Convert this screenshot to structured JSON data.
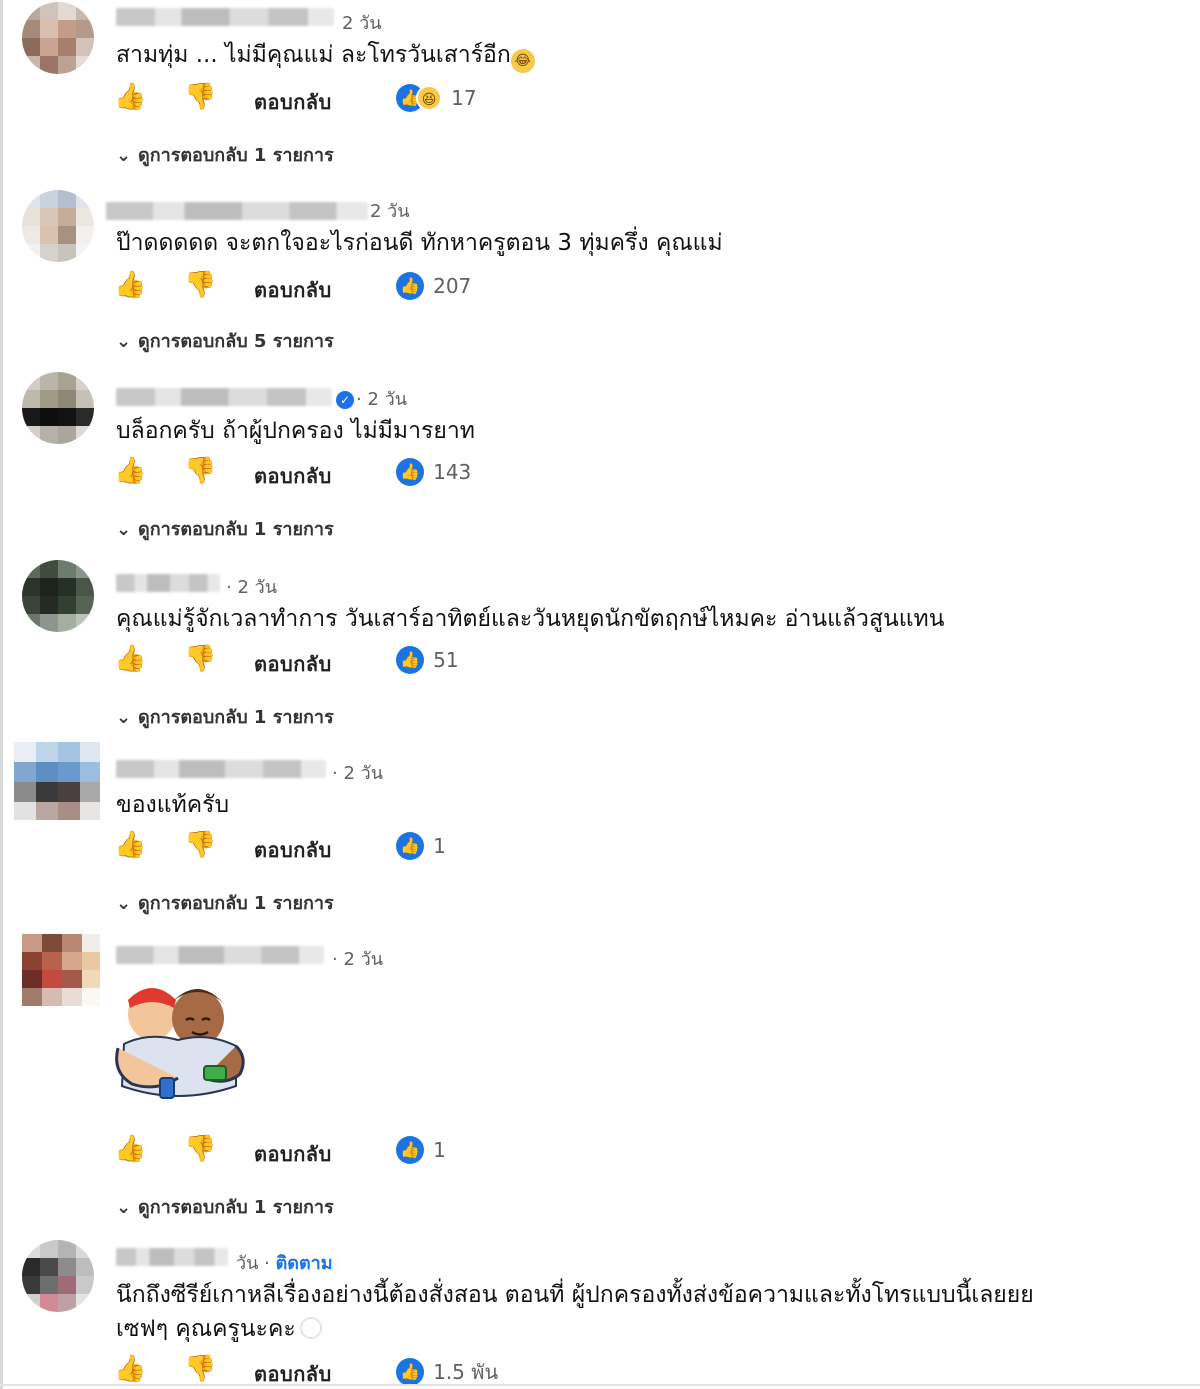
{
  "ui": {
    "reply_label": "ตอบกลับ",
    "like_icon": "thumbs-up-icon",
    "dislike_icon": "thumbs-down-icon",
    "accent": "#1b74e4"
  },
  "comments": [
    {
      "meta": "2 วัน",
      "text": "สามทุ่ม ... ไม่มีคุณแม่ ละโทรวันเสาร์อีก",
      "reactions": "17",
      "replies": "ดูการตอบกลับ 1 รายการ"
    },
    {
      "meta": "2 วัน",
      "text": "ป๊าดดดดด จะตกใจอะไรก่อนดี ทักหาครูตอน 3 ทุ่มครึ่ง คุณแม่",
      "reactions": "207",
      "replies": "ดูการตอบกลับ 5 รายการ"
    },
    {
      "meta": "· 2 วัน",
      "text": "บล็อกครับ ถ้าผู้ปกครอง ไม่มีมารยาท",
      "reactions": "143",
      "replies": "ดูการตอบกลับ 1 รายการ"
    },
    {
      "meta": "· 2 วัน",
      "text": "คุณแม่รู้จักเวลาทำการ วันเสาร์อาทิตย์และวันหยุดนักขัตฤกษ์ไหมคะ อ่านแล้วสูนแทน",
      "reactions": "51",
      "replies": "ดูการตอบกลับ 1 รายการ"
    },
    {
      "meta": "· 2 วัน",
      "text": "ของแท้ครับ",
      "reactions": "1",
      "replies": "ดูการตอบกลับ 1 รายการ"
    },
    {
      "meta": "· 2 วัน",
      "reactions": "1",
      "replies": "ดูการตอบกลับ 1 รายการ"
    },
    {
      "meta": "วัน ·",
      "follow": "ติดตาม",
      "text": "นึกถึงซีรีย์เกาหลีเรื่องอย่างนี้ต้องสั่งสอน ตอนที่ ผู้ปกครองทั้งส่งข้อความและทั้งโทรแบบนี้เลยยย",
      "text2": "เซฟๆ คุณครูนะคะ",
      "reactions": "1.5 พัน"
    }
  ]
}
